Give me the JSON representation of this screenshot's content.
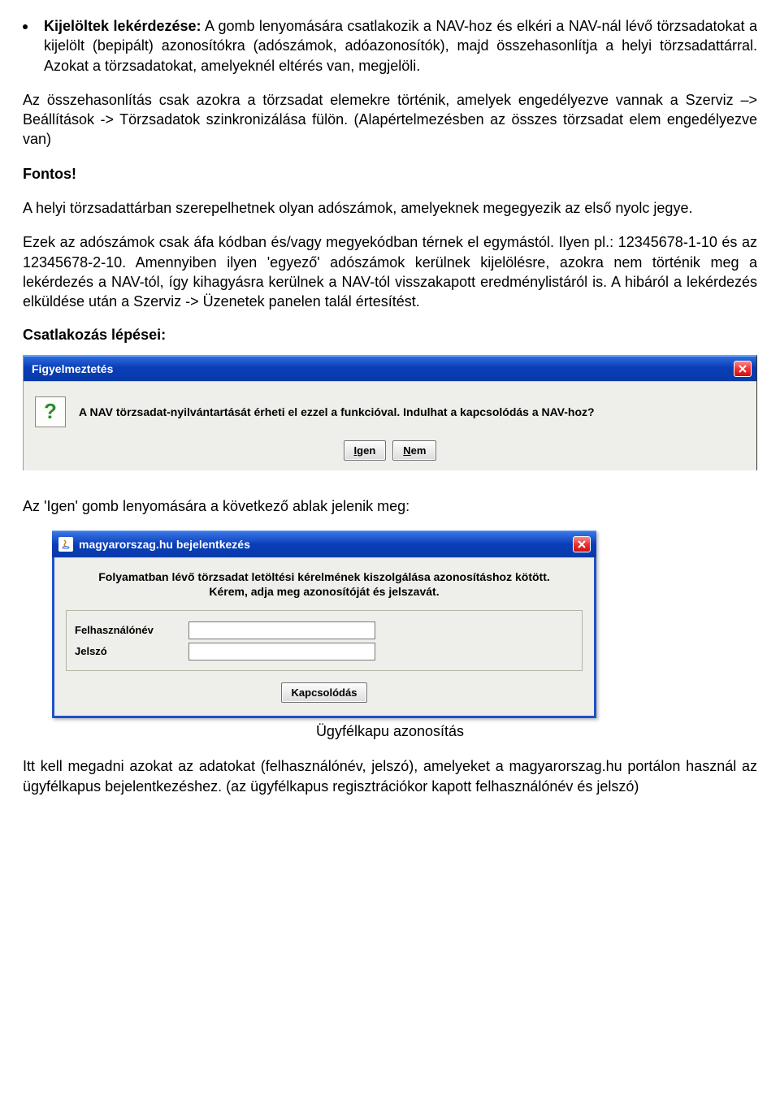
{
  "bullet": {
    "title": "Kijelöltek lekérdezése:",
    "text": " A gomb lenyomására csatlakozik a NAV-hoz és elkéri a NAV-nál lévő törzsadatokat a kijelölt (bepipált) azonosítókra (adószámok, adóazonosítók), majd összehasonlítja a helyi törzsadattárral. Azokat a törzsadatokat, amelyeknél eltérés van, megjelöli."
  },
  "p2": "Az összehasonlítás csak azokra a törzsadat elemekre történik, amelyek engedélyezve vannak a Szerviz –> Beállítások -> Törzsadatok szinkronizálása fülön. (Alapértelmezésben az összes törzsadat elem engedélyezve van)",
  "fontos": "Fontos!",
  "p3": "A helyi törzsadattárban szerepelhetnek olyan adószámok, amelyeknek megegyezik az első nyolc jegye.",
  "p4": "Ezek az adószámok csak áfa kódban és/vagy megyekódban térnek el egymástól. Ilyen pl.: 12345678-1-10 és az 12345678-2-10. Amennyiben ilyen 'egyező' adószámok kerülnek kijelölésre, azokra nem történik meg a lekérdezés a NAV-tól, így kihagyásra kerülnek a NAV-tól visszakapott eredménylistáról is. A hibáról a lekérdezés elküldése után  a Szerviz -> Üzenetek panelen talál értesítést.",
  "steps_heading": "Csatlakozás lépései:",
  "dlg1": {
    "title": "Figyelmeztetés",
    "msg": "A NAV törzsadat-nyilvántartását érheti el ezzel a funkcióval. Indulhat a kapcsolódás a NAV-hoz?",
    "yes_u": "I",
    "yes_rest": "gen",
    "no_u": "N",
    "no_rest": "em"
  },
  "after_dlg1": "Az 'Igen' gomb lenyomására a következő ablak jelenik meg:",
  "dlg2": {
    "title": "magyarorszag.hu bejelentkezés",
    "msg_line1": "Folyamatban lévő törzsadat letöltési kérelmének kiszolgálása azonosításhoz kötött.",
    "msg_line2": "Kérem, adja meg azonosítóját és jelszavát.",
    "user_label": "Felhasználónév",
    "pass_label": "Jelszó",
    "connect": "Kapcsolódás"
  },
  "caption": "Ügyfélkapu azonosítás",
  "p5": "Itt kell megadni azokat az adatokat (felhasználónév, jelszó), amelyeket a magyarorszag.hu portálon használ az ügyfélkapus bejelentkezéshez. (az ügyfélkapus regisztrációkor kapott felhasználónév és jelszó)"
}
